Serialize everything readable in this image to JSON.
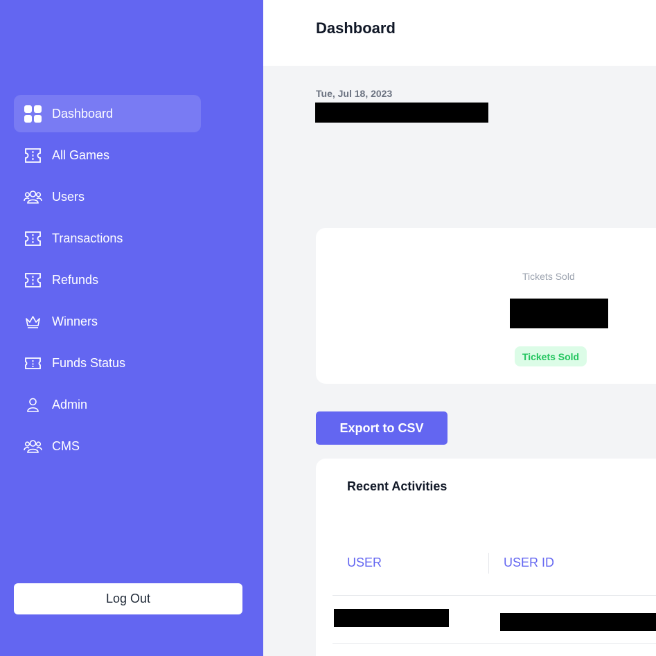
{
  "sidebar": {
    "items": [
      {
        "label": "Dashboard",
        "icon": "grid-icon"
      },
      {
        "label": "All Games",
        "icon": "ticket-icon"
      },
      {
        "label": "Users",
        "icon": "users-icon"
      },
      {
        "label": "Transactions",
        "icon": "ticket-icon"
      },
      {
        "label": "Refunds",
        "icon": "ticket-icon"
      },
      {
        "label": "Winners",
        "icon": "crown-icon"
      },
      {
        "label": "Funds Status",
        "icon": "ticket-icon"
      },
      {
        "label": "Admin",
        "icon": "user-icon"
      },
      {
        "label": "CMS",
        "icon": "users-icon"
      }
    ],
    "active": "Dashboard",
    "logout_label": "Log Out"
  },
  "header": {
    "title": "Dashboard"
  },
  "main": {
    "date": "Tue, Jul 18, 2023",
    "stats": {
      "label": "Tickets Sold",
      "badge": "Tickets Sold"
    },
    "export_label": "Export to CSV",
    "activities": {
      "title": "Recent Activities",
      "columns": [
        "USER",
        "USER ID"
      ]
    }
  },
  "colors": {
    "accent": "#6366f1",
    "badge_bg": "#dcfce7",
    "badge_text": "#22c55e",
    "background": "#f3f4f6"
  }
}
